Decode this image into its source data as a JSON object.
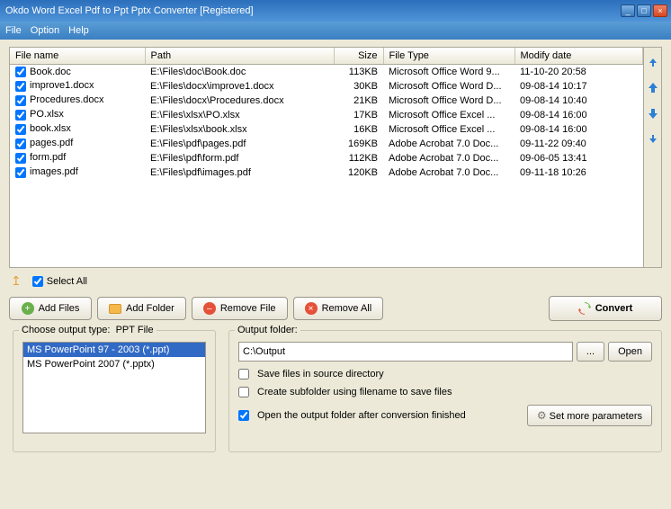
{
  "title": "Okdo Word Excel Pdf to Ppt Pptx Converter [Registered]",
  "menu": {
    "file": "File",
    "option": "Option",
    "help": "Help"
  },
  "headers": {
    "name": "File name",
    "path": "Path",
    "size": "Size",
    "type": "File Type",
    "date": "Modify date"
  },
  "files": [
    {
      "name": "Book.doc",
      "path": "E:\\Files\\doc\\Book.doc",
      "size": "113KB",
      "type": "Microsoft Office Word 9...",
      "date": "11-10-20 20:58"
    },
    {
      "name": "improve1.docx",
      "path": "E:\\Files\\docx\\improve1.docx",
      "size": "30KB",
      "type": "Microsoft Office Word D...",
      "date": "09-08-14 10:17"
    },
    {
      "name": "Procedures.docx",
      "path": "E:\\Files\\docx\\Procedures.docx",
      "size": "21KB",
      "type": "Microsoft Office Word D...",
      "date": "09-08-14 10:40"
    },
    {
      "name": "PO.xlsx",
      "path": "E:\\Files\\xlsx\\PO.xlsx",
      "size": "17KB",
      "type": "Microsoft Office Excel ...",
      "date": "09-08-14 16:00"
    },
    {
      "name": "book.xlsx",
      "path": "E:\\Files\\xlsx\\book.xlsx",
      "size": "16KB",
      "type": "Microsoft Office Excel ...",
      "date": "09-08-14 16:00"
    },
    {
      "name": "pages.pdf",
      "path": "E:\\Files\\pdf\\pages.pdf",
      "size": "169KB",
      "type": "Adobe Acrobat 7.0 Doc...",
      "date": "09-11-22 09:40"
    },
    {
      "name": "form.pdf",
      "path": "E:\\Files\\pdf\\form.pdf",
      "size": "112KB",
      "type": "Adobe Acrobat 7.0 Doc...",
      "date": "09-06-05 13:41"
    },
    {
      "name": "images.pdf",
      "path": "E:\\Files\\pdf\\images.pdf",
      "size": "120KB",
      "type": "Adobe Acrobat 7.0 Doc...",
      "date": "09-11-18 10:26"
    }
  ],
  "selectall": "Select All",
  "buttons": {
    "addFiles": "Add Files",
    "addFolder": "Add Folder",
    "removeFile": "Remove File",
    "removeAll": "Remove All",
    "convert": "Convert"
  },
  "outputType": {
    "label": "Choose output type:",
    "current": "PPT File"
  },
  "formats": [
    {
      "label": "MS PowerPoint 97 - 2003 (*.ppt)",
      "selected": true
    },
    {
      "label": "MS PowerPoint 2007 (*.pptx)",
      "selected": false
    }
  ],
  "output": {
    "label": "Output folder:",
    "path": "C:\\Output",
    "browse": "...",
    "open": "Open",
    "saveSource": "Save files in source directory",
    "createSub": "Create subfolder using filename to save files",
    "openAfter": "Open the output folder after conversion finished",
    "setMore": "Set more parameters"
  }
}
